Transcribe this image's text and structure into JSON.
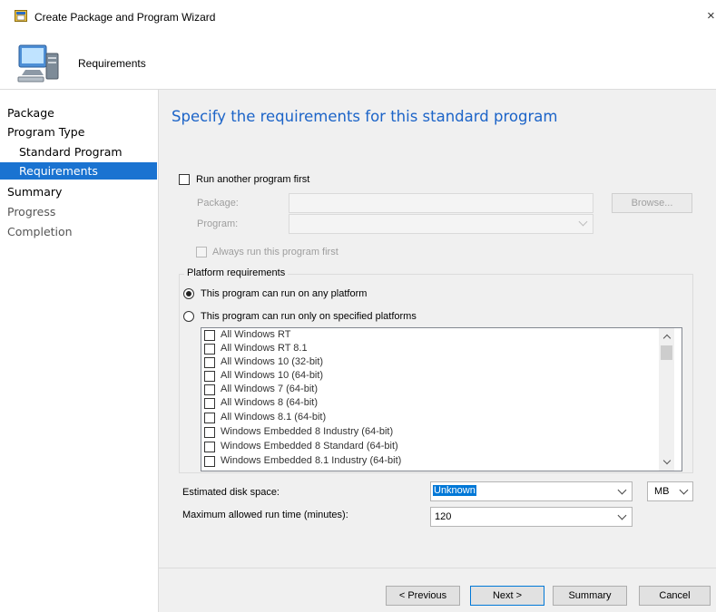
{
  "window": {
    "title": "Create Package and Program Wizard",
    "close_glyph": "×"
  },
  "header": {
    "title": "Requirements"
  },
  "sidebar": {
    "items": [
      {
        "label": "Package"
      },
      {
        "label": "Program Type"
      },
      {
        "label": "Standard Program"
      },
      {
        "label": "Requirements"
      },
      {
        "label": "Summary"
      },
      {
        "label": "Progress"
      },
      {
        "label": "Completion"
      }
    ]
  },
  "main": {
    "heading": "Specify the requirements for this standard program",
    "run_first": {
      "label": "Run another program first",
      "package_label": "Package:",
      "program_label": "Program:",
      "browse_label": "Browse...",
      "always_label": "Always run this program first"
    },
    "platform": {
      "group_label": "Platform requirements",
      "any_label": "This program can run on any platform",
      "specified_label": "This program can run only on specified platforms",
      "items": [
        "All Windows RT",
        "All Windows RT 8.1",
        "All Windows 10 (32-bit)",
        "All Windows 10 (64-bit)",
        "All Windows 7 (64-bit)",
        "All Windows 8 (64-bit)",
        "All Windows 8.1 (64-bit)",
        "Windows Embedded 8 Industry (64-bit)",
        "Windows Embedded 8 Standard (64-bit)",
        "Windows Embedded 8.1 Industry (64-bit)"
      ]
    },
    "disk": {
      "label": "Estimated disk space:",
      "value": "Unknown",
      "unit": "MB"
    },
    "runtime": {
      "label": "Maximum allowed run time (minutes):",
      "value": "120"
    }
  },
  "footer": {
    "previous": "< Previous",
    "next": "Next >",
    "summary": "Summary",
    "cancel": "Cancel"
  }
}
